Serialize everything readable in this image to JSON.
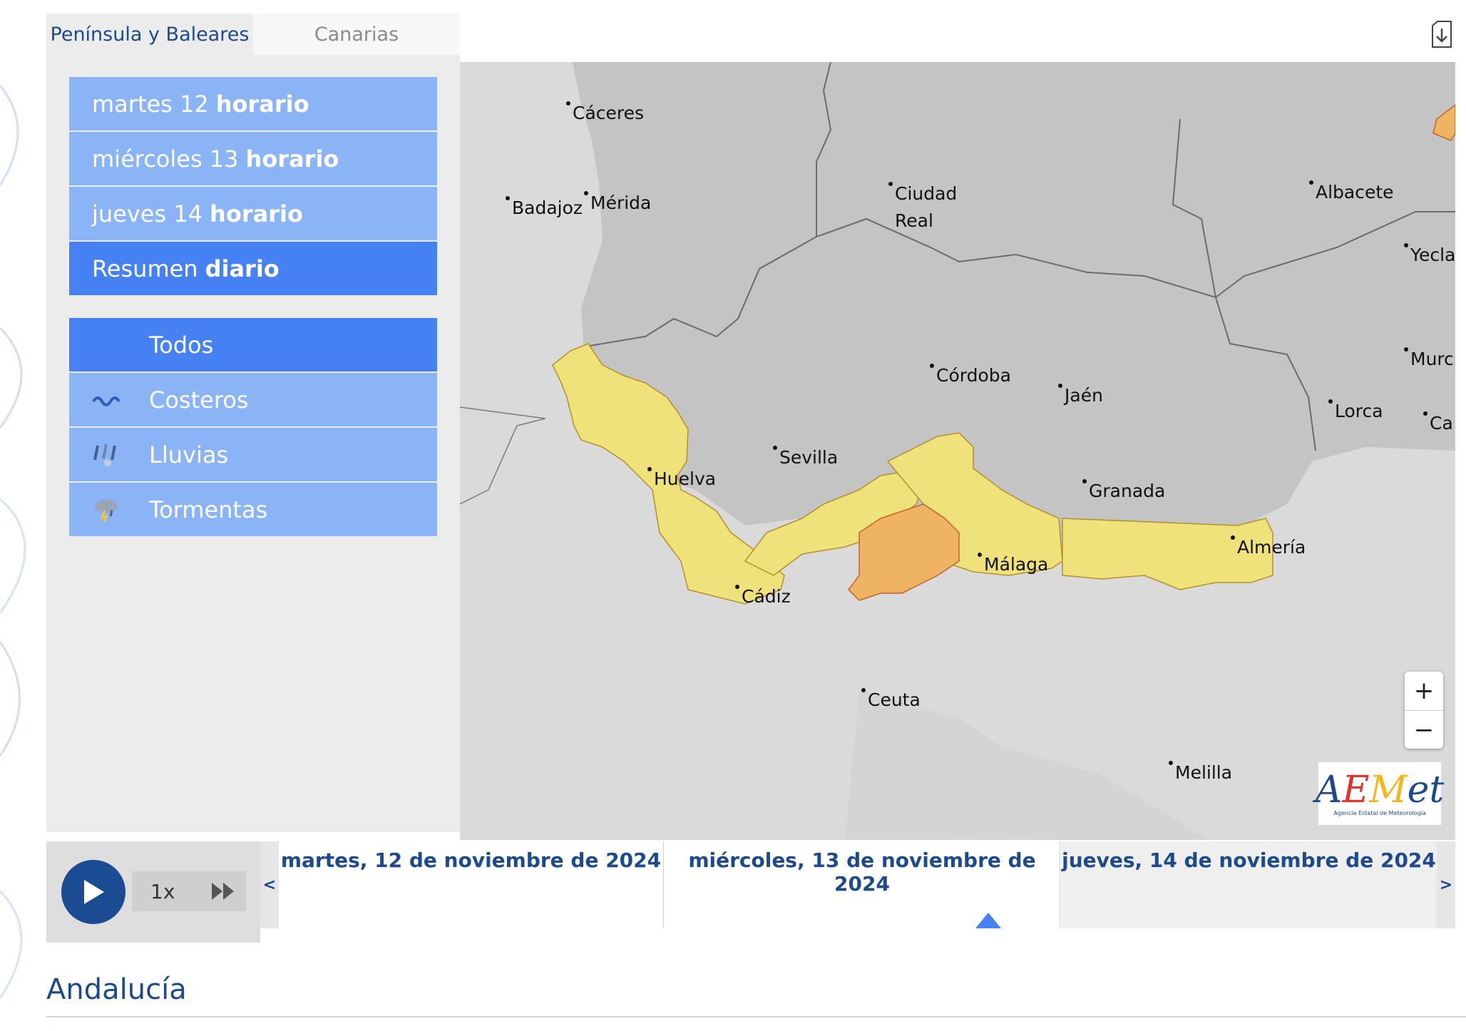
{
  "region_tabs": [
    {
      "label": "Península y Baleares",
      "active": true
    },
    {
      "label": "Canarias",
      "active": false
    }
  ],
  "day_menu": [
    {
      "day": "martes 12",
      "mode": "horario"
    },
    {
      "day": "miércoles 13",
      "mode": "horario"
    },
    {
      "day": "jueves 14",
      "mode": "horario"
    },
    {
      "day": "Resumen",
      "mode": "diario",
      "active": true
    }
  ],
  "filters": [
    {
      "label": "Todos",
      "icon": "all-icon",
      "active": true
    },
    {
      "label": "Costeros",
      "icon": "coastal-waves-icon"
    },
    {
      "label": "Lluvias",
      "icon": "rain-icon"
    },
    {
      "label": "Tormentas",
      "icon": "storm-icon"
    }
  ],
  "map": {
    "cities": [
      "Cáceres",
      "Badajoz",
      "Mérida",
      "Ciudad",
      "Real",
      "Albacete",
      "Yecla",
      "Córdoba",
      "Jaén",
      "Murci",
      "Lorca",
      "Ca",
      "Sevilla",
      "Huelva",
      "Granada",
      "Almería",
      "Málaga",
      "Cádiz",
      "Ceuta",
      "Melilla"
    ],
    "zoom_in": "+",
    "zoom_out": "−",
    "logo": {
      "mark": "AEMet",
      "subtitle": "Agencia Estatal de Meteorología"
    },
    "colors": {
      "sea": "#dadada",
      "land": "#c4c4c4",
      "yellow_warning": "#efe27a",
      "orange_warning": "#eeb464",
      "border": "#6b6b6b"
    }
  },
  "player": {
    "speed": "1x"
  },
  "timeline": {
    "prev": "<",
    "next": ">",
    "days": [
      {
        "label": "martes, 12 de noviembre de 2024"
      },
      {
        "label": "miércoles, 13 de noviembre de 2024"
      },
      {
        "label": "jueves, 14 de noviembre de 2024",
        "selected": true
      }
    ]
  },
  "heading": "Andalucía"
}
